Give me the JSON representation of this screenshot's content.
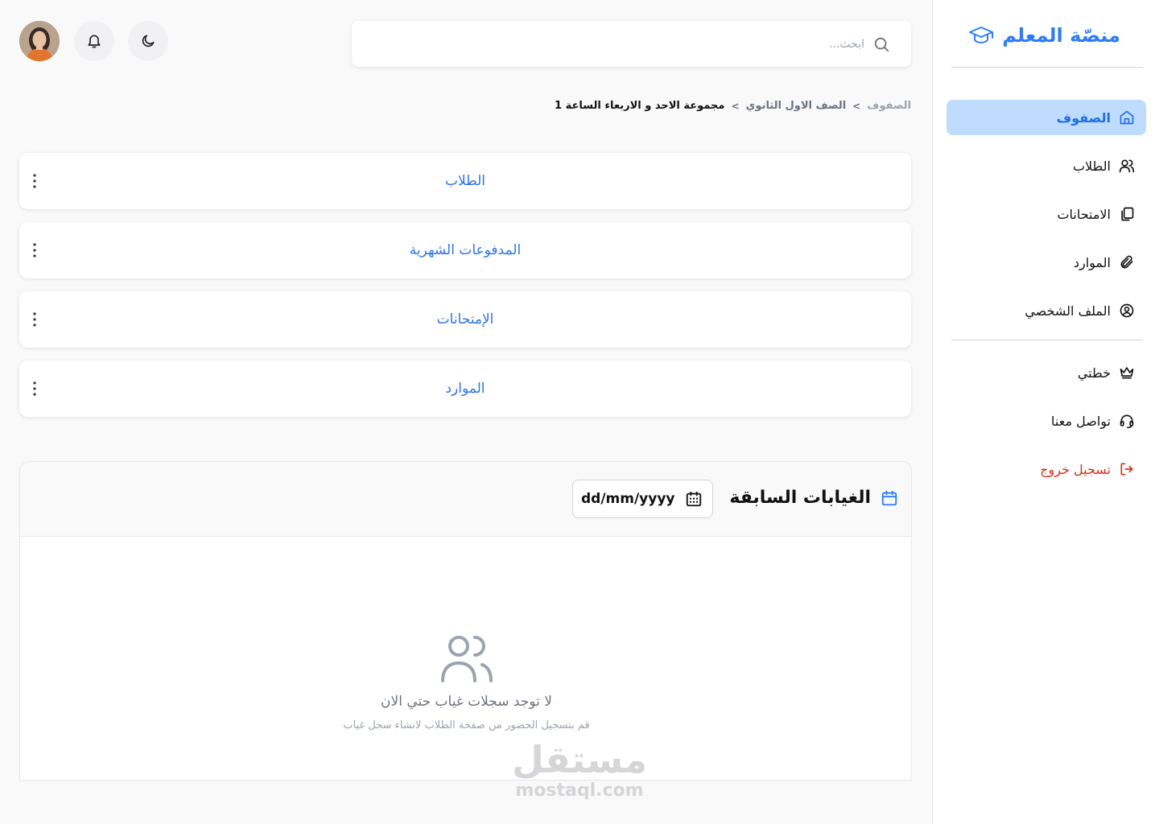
{
  "brand": {
    "name": "منصّة المعلم",
    "accent": "#2f7df6"
  },
  "nav": {
    "items": [
      {
        "label": "الصفوف",
        "icon": "home-icon",
        "active": true
      },
      {
        "label": "الطلاب",
        "icon": "users-icon"
      },
      {
        "label": "الامتحانات",
        "icon": "copy-icon"
      },
      {
        "label": "الموارد",
        "icon": "paperclip-icon"
      },
      {
        "label": "الملف الشخصي",
        "icon": "user-circle-icon"
      }
    ],
    "secondary": [
      {
        "label": "خطتي",
        "icon": "crown-icon"
      },
      {
        "label": "تواصل معنا",
        "icon": "headset-icon"
      },
      {
        "label": "تسجيل خروج",
        "icon": "logout-icon",
        "color": "#d6301a"
      }
    ]
  },
  "search": {
    "placeholder": "ابحث..."
  },
  "breadcrumb": {
    "items": [
      "الصفوف",
      "الصف الاول الثانوي",
      "مجموعة الاحد و الاربعاء الساعة 1"
    ],
    "separator": ">"
  },
  "cards": [
    {
      "label": "الطلاب"
    },
    {
      "label": "المدفوعات الشهرية"
    },
    {
      "label": "الإمتحانات"
    },
    {
      "label": "الموارد"
    }
  ],
  "absences": {
    "title": "الغيابات السابقة",
    "date_placeholder": "dd/mm/yyyy",
    "empty_title": "لا توجد سجلات غياب حتي الان",
    "empty_subtitle": "قم بتسجيل الحضور من صفحة الطلاب لانشاء سجل غياب"
  },
  "watermark": {
    "ar": "مستقل",
    "en": "mostaql.com"
  }
}
